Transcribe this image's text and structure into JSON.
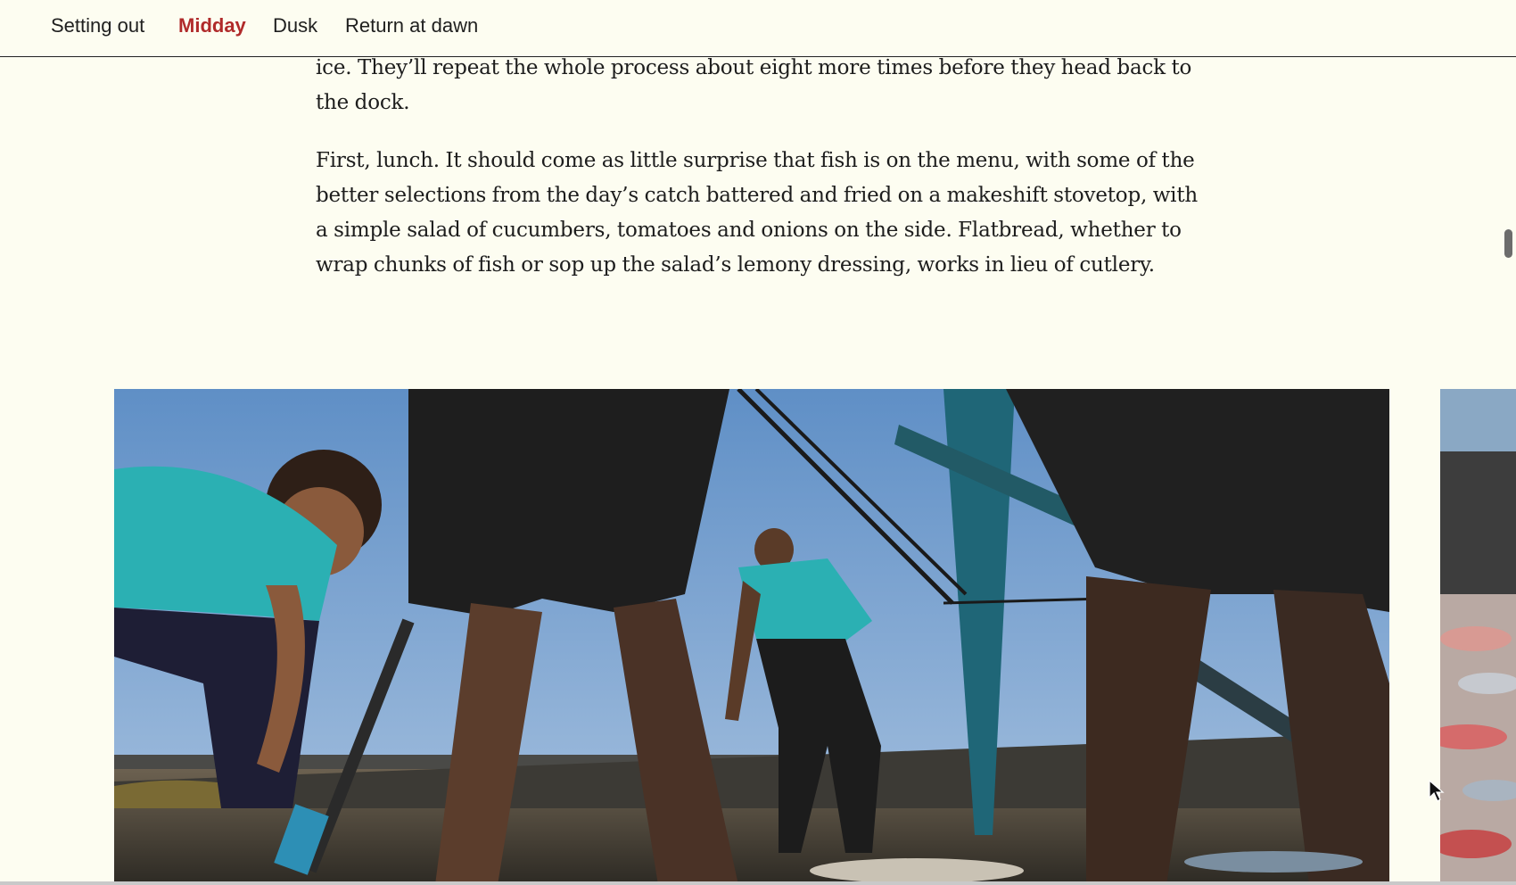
{
  "nav": {
    "items": [
      {
        "label": "Setting out",
        "active": false
      },
      {
        "label": "Midday",
        "active": true
      },
      {
        "label": "Dusk",
        "active": false
      },
      {
        "label": "Return at dawn",
        "active": false
      }
    ],
    "active_color": "#b02a2a"
  },
  "article": {
    "paragraphs": [
      "ice. They’ll repeat the whole process about eight more times before they head back to the dock.",
      "First, lunch. It should come as little surprise that fish is on the menu, with some of the better selections from the day’s catch battered and fried on a makeshift stovetop, with a simple salad of cucumbers, tomatoes and onions on the side. Flatbread, whether to wrap chunks of fish or sop up the salad’s lemony dressing, works in lieu of cutlery."
    ]
  },
  "colors": {
    "page_background": "#fdfdf1",
    "text": "#1d1d1d",
    "sky": "#8fb0d8"
  }
}
